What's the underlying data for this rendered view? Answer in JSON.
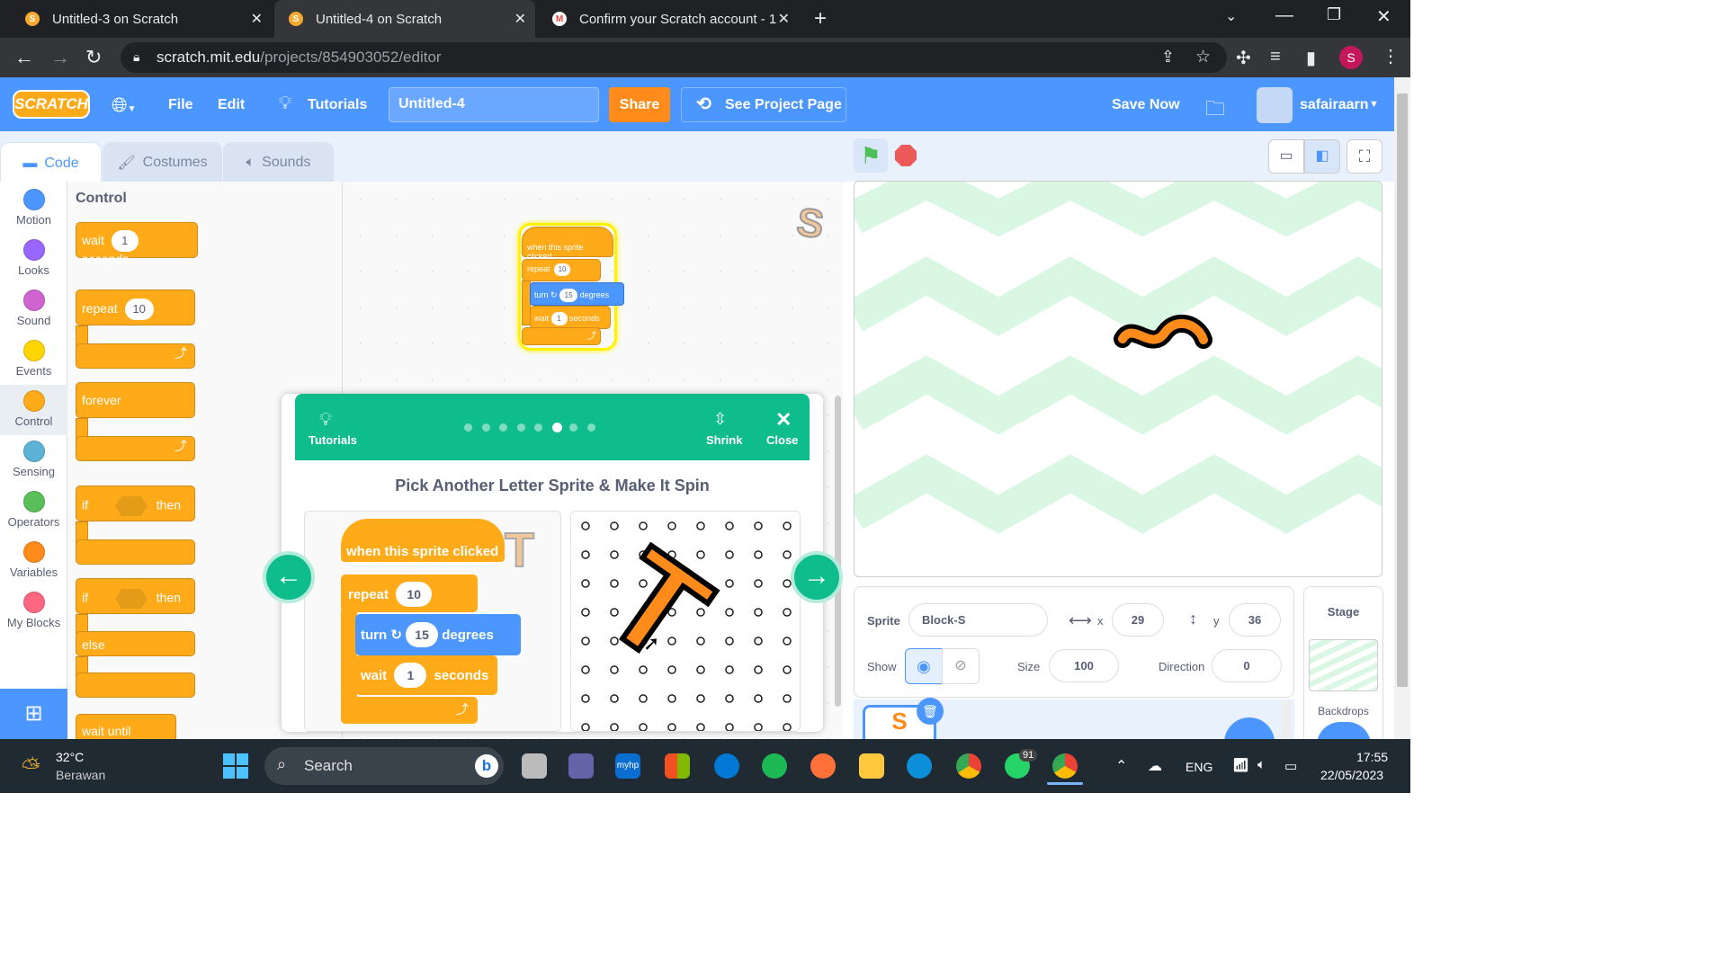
{
  "browser": {
    "tabs": [
      {
        "title": "Untitled-3 on Scratch"
      },
      {
        "title": "Untitled-4 on Scratch"
      },
      {
        "title": "Confirm your Scratch account - 1"
      }
    ],
    "url_host": "scratch.mit.edu",
    "url_path": "/projects/854903052/editor",
    "profile_initial": "S"
  },
  "menubar": {
    "logo": "SCRATCH",
    "file": "File",
    "edit": "Edit",
    "tutorials": "Tutorials",
    "project_title": "Untitled-4",
    "share": "Share",
    "see_project_page": "See Project Page",
    "save_now": "Save Now",
    "username": "safairaarn"
  },
  "editor_tabs": {
    "code": "Code",
    "costumes": "Costumes",
    "sounds": "Sounds"
  },
  "categories": [
    {
      "label": "Motion",
      "color": "#4c97ff"
    },
    {
      "label": "Looks",
      "color": "#9966ff"
    },
    {
      "label": "Sound",
      "color": "#cf63cf"
    },
    {
      "label": "Events",
      "color": "#ffd500"
    },
    {
      "label": "Control",
      "color": "#ffab19"
    },
    {
      "label": "Sensing",
      "color": "#5cb1d6"
    },
    {
      "label": "Operators",
      "color": "#59c059"
    },
    {
      "label": "Variables",
      "color": "#ff8c1a"
    },
    {
      "label": "My Blocks",
      "color": "#ff6680"
    }
  ],
  "palette": {
    "heading": "Control",
    "wait_label": "wait",
    "wait_value": "1",
    "seconds_label": "seconds",
    "repeat_label": "repeat",
    "repeat_value": "10",
    "forever_label": "forever",
    "if_label": "if",
    "then_label": "then",
    "else_label": "else",
    "wait_until_label": "wait until"
  },
  "script": {
    "hat": "when this sprite clicked",
    "repeat": "repeat",
    "repeat_value": "10",
    "turn": "turn",
    "turn_value": "15",
    "degrees": "degrees",
    "wait": "wait",
    "wait_value": "1",
    "seconds": "seconds"
  },
  "tutorial": {
    "tutorials_label": "Tutorials",
    "shrink": "Shrink",
    "close": "Close",
    "heading": "Pick Another Letter Sprite & Make It Spin",
    "steps_total": 8,
    "current_step": 6,
    "example_hat": "when this sprite clicked",
    "example_repeat": "repeat",
    "example_repeat_value": "10",
    "example_turn": "turn",
    "example_turn_value": "15",
    "example_degrees": "degrees",
    "example_wait": "wait",
    "example_wait_value": "1",
    "example_seconds": "seconds",
    "letter": "T"
  },
  "sprite_info": {
    "sprite_label": "Sprite",
    "sprite_name": "Block-S",
    "x_label": "x",
    "x_value": "29",
    "y_label": "y",
    "y_value": "36",
    "show_label": "Show",
    "size_label": "Size",
    "size_value": "100",
    "direction_label": "Direction",
    "direction_value": "0"
  },
  "stage_panel": {
    "title": "Stage",
    "backdrops": "Backdrops"
  },
  "taskbar": {
    "weather_temp": "32°C",
    "weather_desc": "Berawan",
    "search_placeholder": "Search",
    "whatsapp_badge": "91",
    "language": "ENG",
    "time": "17:55",
    "date": "22/05/2023"
  },
  "colors": {
    "scratch_blue": "#4c97ff",
    "control_orange": "#ffab19",
    "tutorial_green": "#0fbd8c",
    "share_orange": "#ff8c1a"
  }
}
